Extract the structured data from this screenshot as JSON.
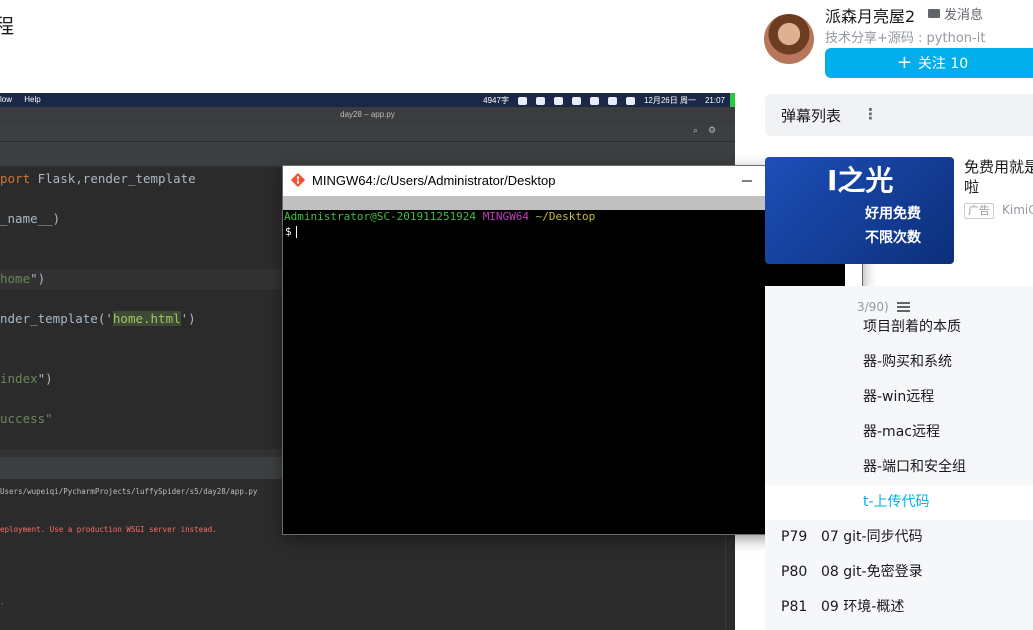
{
  "page": {
    "title_fragment": "程"
  },
  "ide": {
    "mac_menu": [
      "low",
      "Help"
    ],
    "mac_status": {
      "word_count": "4947字",
      "date": "12月26日 周一",
      "time": "21:07"
    },
    "window_title": "day28 – app.py",
    "code_lines": [
      {
        "pre": "",
        "kw": "port",
        "post": " Flask,render_template"
      },
      {
        "text": "_name__)"
      },
      {
        "pre": "",
        "str": "home",
        "post": "\")"
      },
      {
        "pre": "nder_template('",
        "strbox": "home.html",
        "post": "')"
      },
      {
        "pre": "",
        "str": "index",
        "post": "\")"
      },
      {
        "str": "uccess\""
      }
    ],
    "run_path": "Users/wupeiqi/PycharmProjects/luffySpider/s5/day28/app.py",
    "run_error": "eployment. Use a production WSGI server instead.",
    "run_dash": "-"
  },
  "terminal": {
    "title": "MINGW64:/c/Users/Administrator/Desktop",
    "user_host": "Administrator@SC-201911251924",
    "shell": "MINGW64",
    "cwd": "~/Desktop",
    "prompt": "$"
  },
  "uploader": {
    "name": "派森月亮屋2",
    "message_label": "发消息",
    "description": "技术分享+源码 : python-it",
    "follow_label": "关注 10"
  },
  "danmaku": {
    "label": "弹幕列表"
  },
  "ad": {
    "headline": "I之光",
    "line1": "好用免费",
    "line2": "不限次数",
    "text": "免费用就是啦",
    "tag": "广告",
    "source": "KimiC"
  },
  "playlist": {
    "count": "3/90)",
    "items": [
      {
        "p": "",
        "title": "项目剖着的本质"
      },
      {
        "p": "",
        "title": "器-购买和系统"
      },
      {
        "p": "",
        "title": "器-win远程"
      },
      {
        "p": "",
        "title": "器-mac远程"
      },
      {
        "p": "",
        "title": "器-端口和安全组"
      },
      {
        "p": "",
        "title": "t-上传代码",
        "active": true
      },
      {
        "p": "P79",
        "title": "07 git-同步代码"
      },
      {
        "p": "P80",
        "title": "08 git-免密登录"
      },
      {
        "p": "P81",
        "title": "09 环境-概述"
      }
    ]
  },
  "colors": {
    "accent": "#00aeec",
    "terminal_user": "#3fbf3f",
    "terminal_shell": "#c03fbf",
    "terminal_cwd": "#bfbf3f"
  }
}
